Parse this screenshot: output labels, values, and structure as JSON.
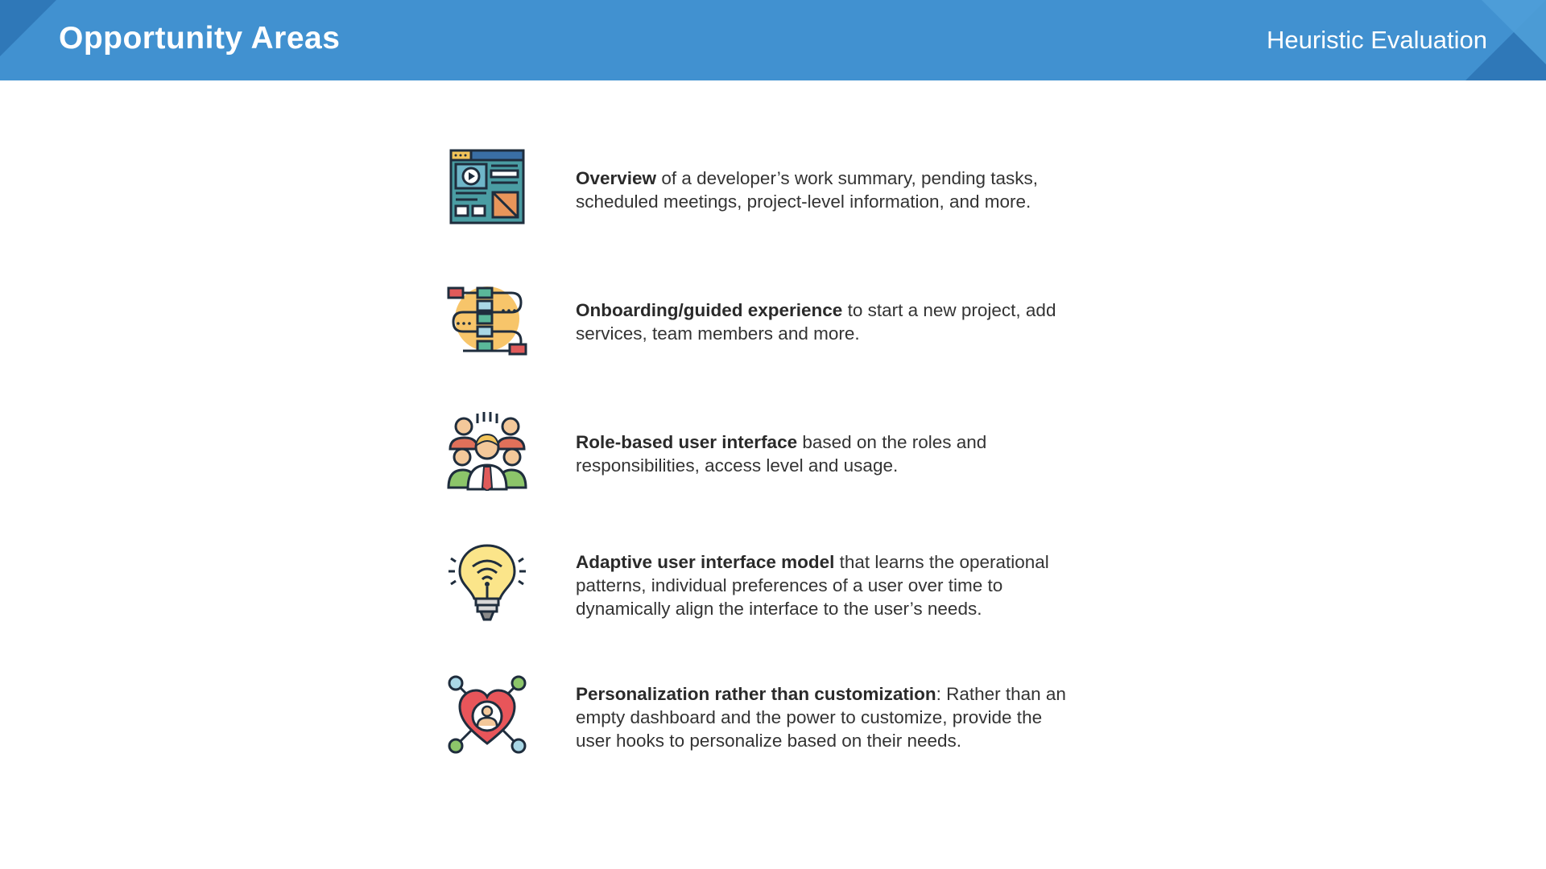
{
  "header": {
    "title": "Opportunity Areas",
    "subtitle": "Heuristic Evaluation",
    "color": "#4191d0"
  },
  "items": [
    {
      "icon": "dashboard-icon",
      "bold": "Overview",
      "text": " of a developer’s work summary, pending tasks, scheduled meetings, project-level information, and more."
    },
    {
      "icon": "workflow-icon",
      "bold": "Onboarding/guided experience",
      "text": " to start a new project, add services, team members and more."
    },
    {
      "icon": "team-icon",
      "bold": "Role-based user interface",
      "text": " based on the roles and responsibilities, access level and usage."
    },
    {
      "icon": "smart-bulb-icon",
      "bold": "Adaptive user interface model",
      "text": " that learns the operational patterns, individual preferences of a user over time to dynamically align the interface to the user’s needs."
    },
    {
      "icon": "heart-user-icon",
      "bold": "Personalization rather than customization",
      "text": ": Rather than an empty dashboard and the power to customize, provide the user hooks to personalize based on their needs."
    }
  ]
}
